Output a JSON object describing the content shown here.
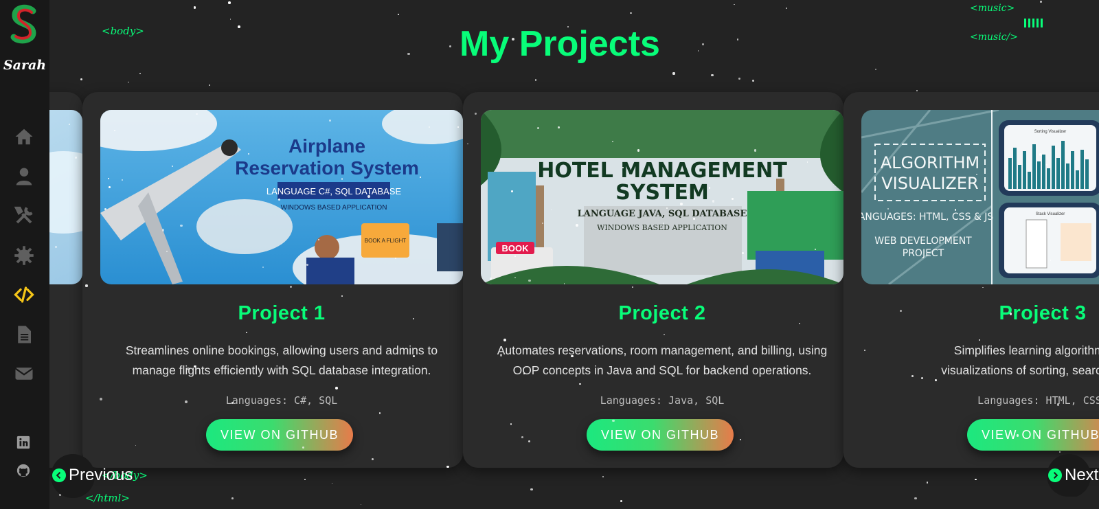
{
  "sidebar": {
    "logo_letter": "S",
    "name": "Sarah",
    "nav_items": [
      "home-icon",
      "user-icon",
      "tools-icon",
      "gear-icon",
      "code-icon",
      "file-icon",
      "mail-icon"
    ],
    "active_item": "code-icon",
    "social": [
      "linkedin-icon",
      "github-icon"
    ]
  },
  "decor": {
    "body_open": "<body>",
    "body_close": "</body>",
    "html_close": "</html>",
    "music_open": "<music>",
    "music_close": "<music/>",
    "music_bars": "IIIII"
  },
  "page": {
    "title": "My Projects"
  },
  "projects": [
    {
      "image_title": "Airplane Reservation System",
      "image_title_line1": "Airplane",
      "image_title_line2": "Reservation System",
      "image_sub": "LANGUAGE C#, SQL DATABASE",
      "image_sub2": "WINDOWS BASED APPLICATION",
      "image_badge": "BOOK A FLIGHT",
      "title": "Project 1",
      "desc_line1": "Streamlines online bookings, allowing users and admins to",
      "desc_line2": "manage flights efficiently with SQL database integration.",
      "languages": "Languages: C#, SQL",
      "button": "VIEW ON GITHUB"
    },
    {
      "image_title_line1": "HOTEL MANAGEMENT",
      "image_title_line2": "SYSTEM",
      "image_sub": "LANGUAGE JAVA, SQL DATABASE",
      "image_sub2": "WINDOWS BASED APPLICATION",
      "image_badge": "BOOK",
      "title": "Project 2",
      "desc_line1": "Automates reservations, room management, and billing, using",
      "desc_line2": "OOP concepts in Java and SQL for backend operations.",
      "languages": "Languages: Java, SQL",
      "button": "VIEW ON GITHUB"
    },
    {
      "image_title_line1": "ALGORITHM",
      "image_title_line2": "VISUALIZER",
      "image_sub": "LANGUAGES: HTML, CSS & JS",
      "image_sub2": "WEB DEVELOPMENT",
      "image_sub3": "PROJECT",
      "image_panel1": "Sorting Visualizer",
      "image_panel2": "Stack Visualizer",
      "title": "Project 3",
      "desc_line1": "Simplifies learning algorithms by of",
      "desc_line2": "visualizations of sorting, searching & pa",
      "languages": "Languages: HTML, CSS,",
      "button": "VIEW ON GITHUB"
    }
  ],
  "nav": {
    "previous": "Previous",
    "next": "Next"
  },
  "colors": {
    "accent": "#08fd79",
    "active_icon": "#f5c518",
    "background": "#232323",
    "card": "#2b2b2b"
  }
}
